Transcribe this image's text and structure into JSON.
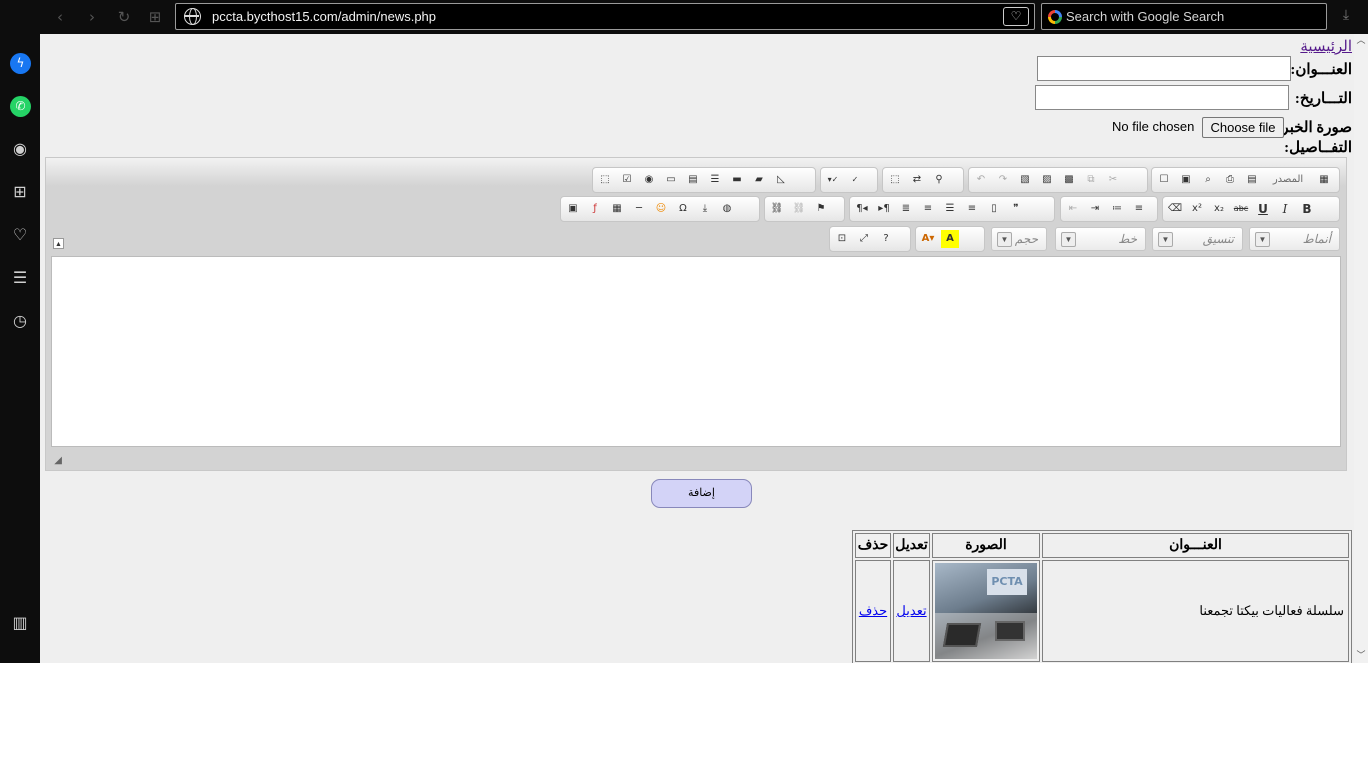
{
  "browser": {
    "url": "pccta.bycthost15.com/admin/news.php",
    "search_placeholder": "Search with Google Search",
    "nav": {
      "back": "‹",
      "forward": "›",
      "reload": "↻",
      "tabs": "⊞",
      "download": "⤓"
    }
  },
  "sidebar": {
    "items": [
      {
        "name": "messenger-icon",
        "glyph": "ϟ"
      },
      {
        "name": "whatsapp-icon",
        "glyph": "✆"
      },
      {
        "name": "camera-icon",
        "glyph": "◉"
      },
      {
        "name": "apps-icon",
        "glyph": "⊞"
      },
      {
        "name": "favorites-icon",
        "glyph": "♡"
      },
      {
        "name": "news-icon",
        "glyph": "☰"
      },
      {
        "name": "history-icon",
        "glyph": "◷"
      },
      {
        "name": "sidebar-toggle-icon",
        "glyph": "▥"
      }
    ]
  },
  "page": {
    "home_link": "الرئيسية",
    "title_label": "العنـــوان:",
    "date_label": "التـــاريخ:",
    "image_label": "صورة الخبر:",
    "choose_file": "Choose file",
    "no_file": "No file chosen",
    "details_label": "التفــاصيل:",
    "add_button": "إضافة"
  },
  "editor": {
    "format_combo": "تنسيق",
    "font_combo": "خط",
    "size_combo": "حجم",
    "styles_combo": "أنماط",
    "source_label": "المصدر",
    "collapse_glyph": "▲",
    "resize_glyph": "◢"
  },
  "table": {
    "headers": {
      "title": "العنـــوان",
      "image": "الصورة",
      "edit": "تعديل",
      "delete": "حذف"
    },
    "rows": [
      {
        "title": "سلسلة فعاليات بيكتا تجمعنا",
        "image_caption": "PCTA",
        "edit": "تعديل",
        "delete": "حذف"
      }
    ]
  }
}
